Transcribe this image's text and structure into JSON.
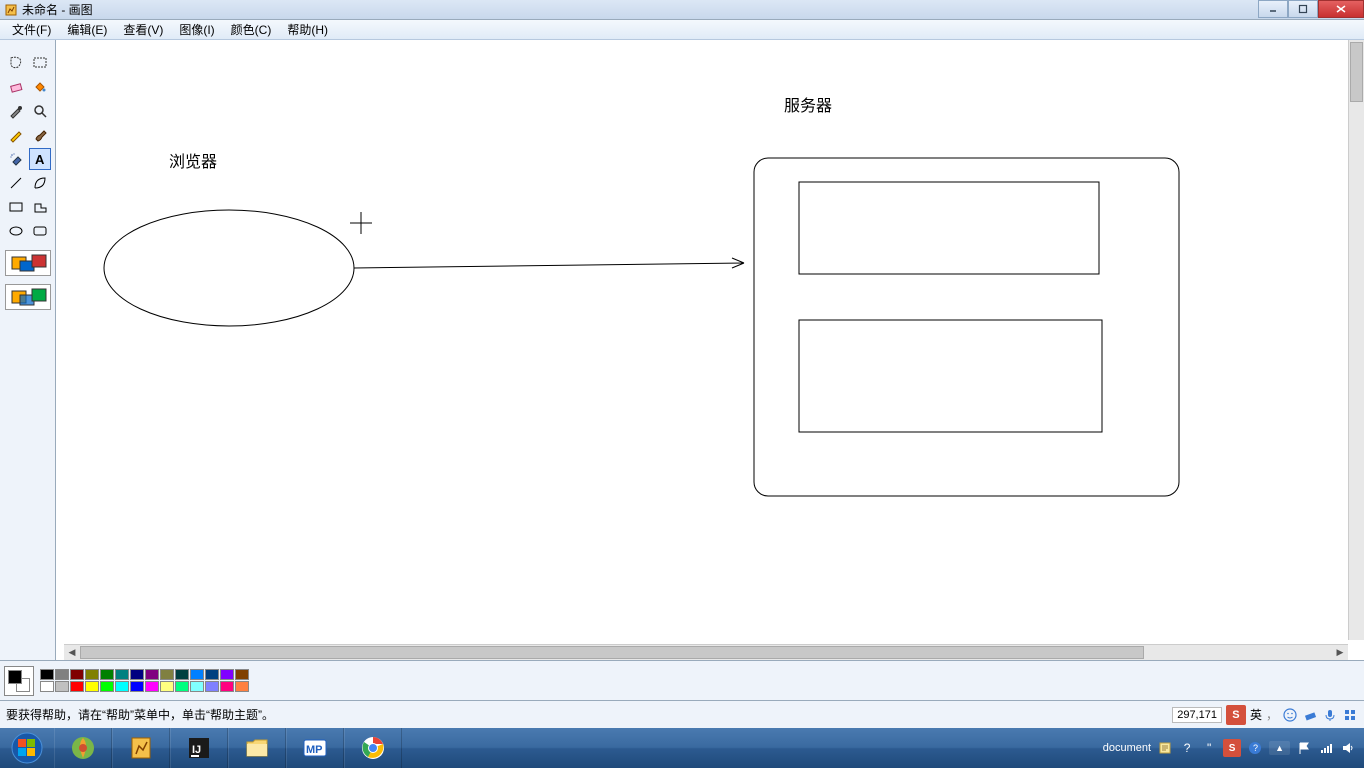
{
  "title": "未命名 - 画图",
  "menu": {
    "file": "文件(F)",
    "edit": "编辑(E)",
    "view": "查看(V)",
    "image": "图像(I)",
    "color": "颜色(C)",
    "help": "帮助(H)"
  },
  "canvas": {
    "label_browser": "浏览器",
    "label_server": "服务器"
  },
  "palette": {
    "row1": [
      "#000000",
      "#808080",
      "#800000",
      "#808000",
      "#008000",
      "#008080",
      "#000080",
      "#800080",
      "#808040",
      "#004040",
      "#0080ff",
      "#004080",
      "#8000ff",
      "#804000"
    ],
    "row2": [
      "#ffffff",
      "#c0c0c0",
      "#ff0000",
      "#ffff00",
      "#00ff00",
      "#00ffff",
      "#0000ff",
      "#ff00ff",
      "#ffff80",
      "#00ff80",
      "#80ffff",
      "#8080ff",
      "#ff0080",
      "#ff8040"
    ]
  },
  "statusbar": {
    "help_text": "要获得帮助，请在“帮助”菜单中，单击“帮助主题”。",
    "coords": "297,171",
    "ime_lang": "英"
  },
  "taskbar": {
    "document_label": "document"
  }
}
